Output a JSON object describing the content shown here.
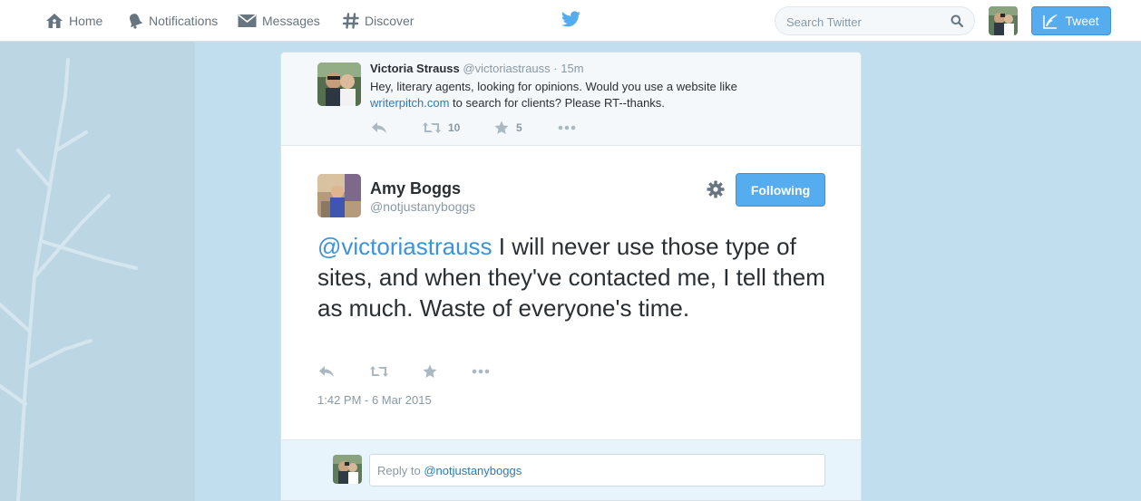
{
  "nav": {
    "home": "Home",
    "notifications": "Notifications",
    "messages": "Messages",
    "discover": "Discover"
  },
  "search": {
    "placeholder": "Search Twitter"
  },
  "tweet_button": "Tweet",
  "ancestor": {
    "name": "Victoria Strauss",
    "handle": "@victoriastrauss",
    "separator": "·",
    "time": "15m",
    "text_before": "Hey, literary agents, looking for opinions. Would you use a website like",
    "link": "writerpitch.com",
    "text_after": "to search for clients? Please RT--thanks.",
    "retweets": "10",
    "favorites": "5"
  },
  "main": {
    "name": "Amy Boggs",
    "handle": "@notjustanyboggs",
    "follow_label": "Following",
    "mention": "@victoriastrauss",
    "text": "I will never use those type of sites, and when they've contacted me, I tell them as much. Waste of everyone's time.",
    "timestamp": "1:42 PM - 6 Mar 2015"
  },
  "reply": {
    "prefix": "Reply to",
    "mention": "@notjustanyboggs"
  },
  "colors": {
    "accent": "#55acee",
    "link": "#2b7bb9",
    "muted": "#8899a6",
    "background": "#c0deed"
  }
}
